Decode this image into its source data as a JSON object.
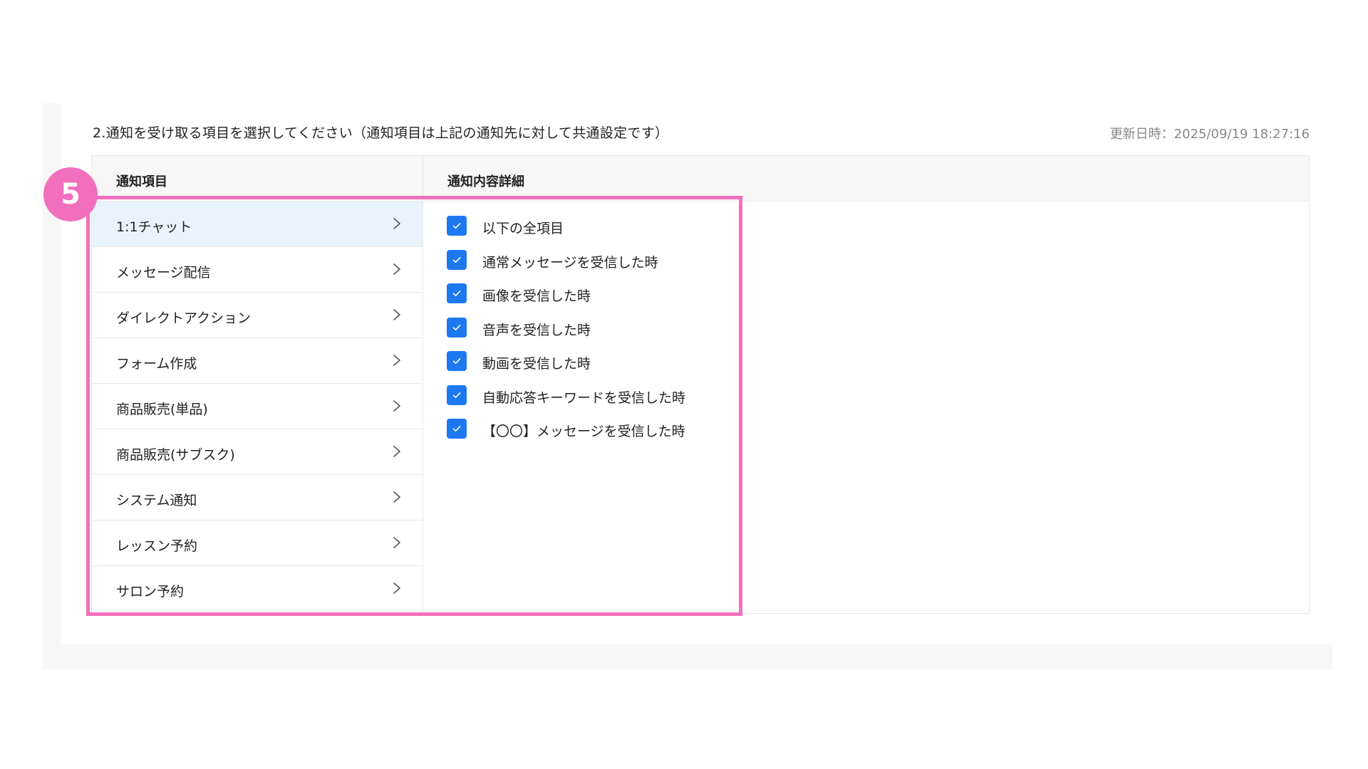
{
  "section": {
    "title": "2.通知を受け取る項目を選択してください（通知項目は上記の通知先に対して共通設定です）",
    "updated_at": "更新日時：2025/09/19 18:27:16"
  },
  "table": {
    "header_items": "通知項目",
    "header_detail": "通知内容詳細"
  },
  "items": [
    {
      "label": "1:1チャット",
      "active": true
    },
    {
      "label": "メッセージ配信",
      "active": false
    },
    {
      "label": "ダイレクトアクション",
      "active": false
    },
    {
      "label": "フォーム作成",
      "active": false
    },
    {
      "label": "商品販売(単品)",
      "active": false
    },
    {
      "label": "商品販売(サブスク)",
      "active": false
    },
    {
      "label": "システム通知",
      "active": false
    },
    {
      "label": "レッスン予約",
      "active": false
    },
    {
      "label": "サロン予約",
      "active": false
    }
  ],
  "details": [
    {
      "label": "以下の全項目",
      "checked": true
    },
    {
      "label": "通常メッセージを受信した時",
      "checked": true
    },
    {
      "label": "画像を受信した時",
      "checked": true
    },
    {
      "label": "音声を受信した時",
      "checked": true
    },
    {
      "label": "動画を受信した時",
      "checked": true
    },
    {
      "label": "自動応答キーワードを受信した時",
      "checked": true
    },
    {
      "label": "【〇〇】メッセージを受信した時",
      "checked": true
    }
  ],
  "annotation": {
    "step_number": "5",
    "color": "#f26fbd"
  },
  "colors": {
    "checkbox": "#1e78f0",
    "active_row": "#e9f3fe"
  },
  "icons": {
    "chevron": "chevron-right-icon",
    "check": "check-icon"
  }
}
